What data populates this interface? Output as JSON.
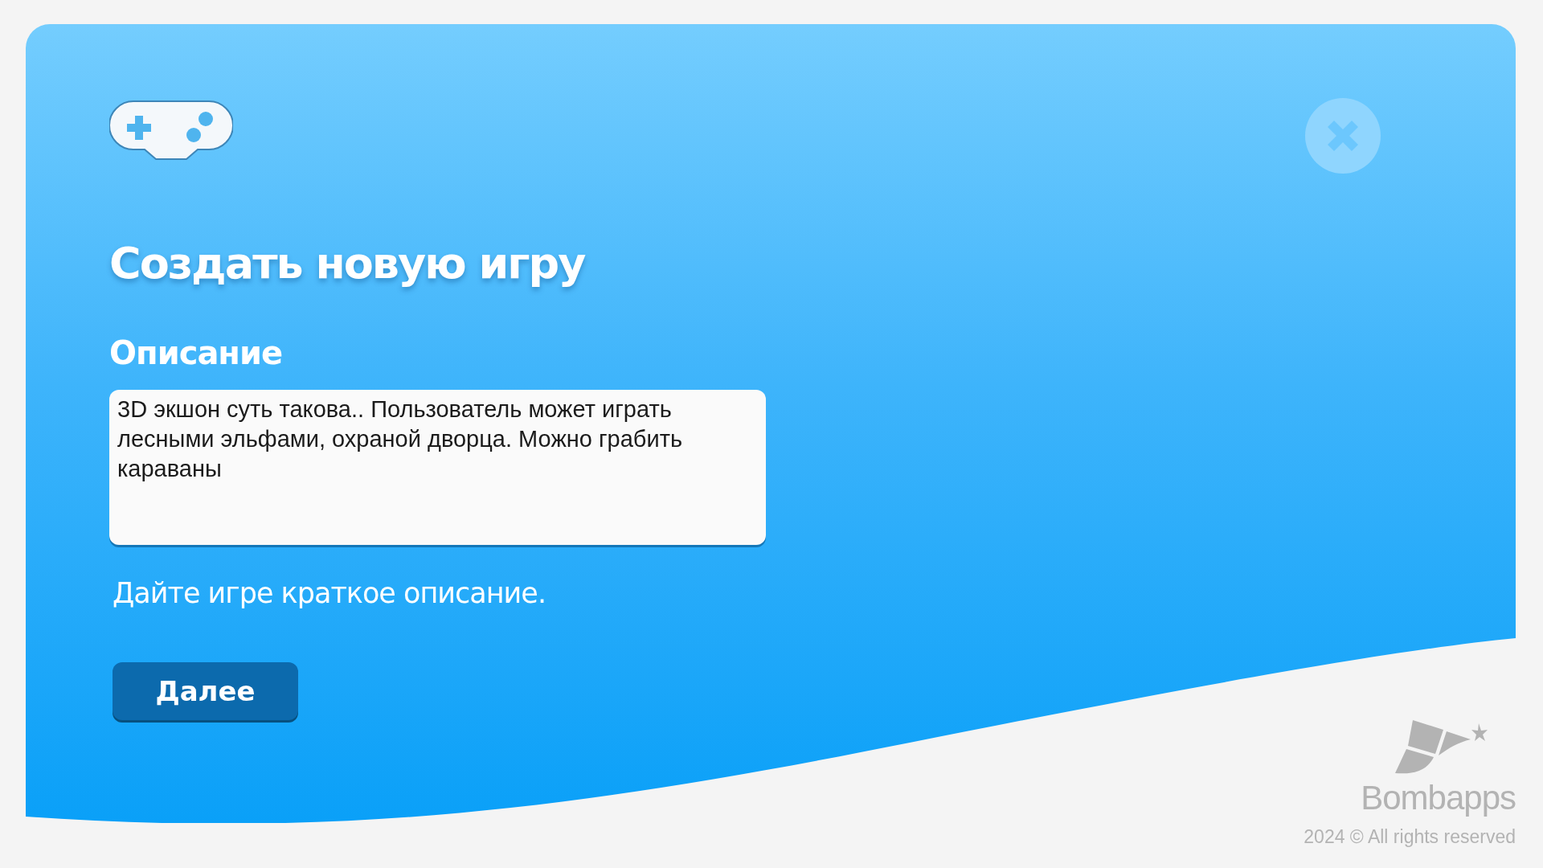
{
  "title": "Создать новую игру",
  "description_label": "Описание",
  "description_field": {
    "value": "3D экшон суть такова.. Пользователь может играть лесными эльфами, охраной дворца. Можно грабить караваны"
  },
  "hint": "Дайте игре краткое описание.",
  "next_button": "Далее",
  "brand": {
    "name": "Bombapps",
    "copyright": "2024 © All rights reserved"
  }
}
